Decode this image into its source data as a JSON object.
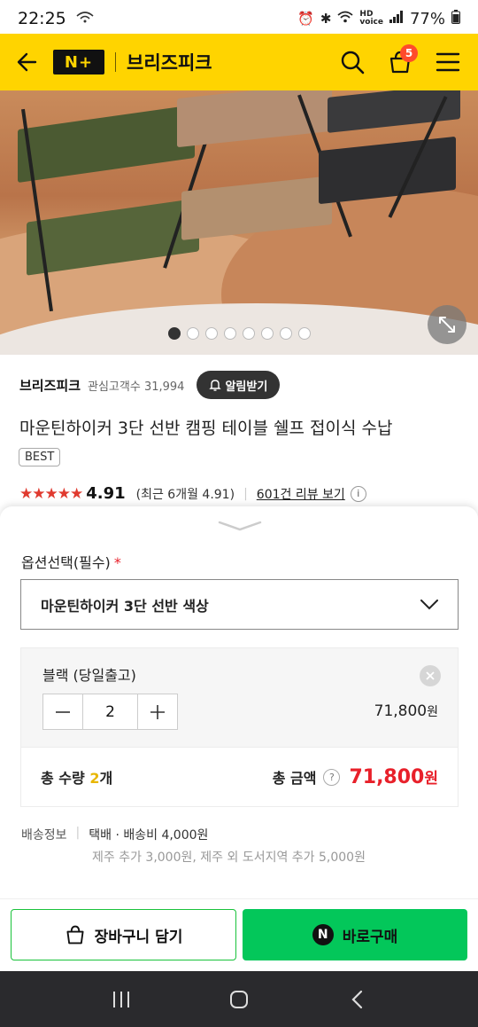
{
  "status_bar": {
    "time": "22:25",
    "left_icons": "wifi",
    "battery": "77%",
    "right_icons": [
      "alarm-icon",
      "bluetooth-icon",
      "wifi-icon",
      "hd-voice-icon",
      "signal-icon",
      "battery-icon"
    ]
  },
  "header": {
    "logo": "N+",
    "title": "브리즈피크",
    "cart_count": "5",
    "bg_color": "#ffd400"
  },
  "hero": {
    "slide_count": 8,
    "active_slide": 1
  },
  "product": {
    "store_name": "브리즈피크",
    "followers": "관심고객수 31,994",
    "alert_button": "알림받기",
    "title": "마운틴하이커 3단 선반 캠핑 테이블 쉘프 접이식 수납",
    "badge": "BEST",
    "stars": "★★★★★",
    "score": "4.91",
    "recent_score": "(최근 6개월 4.91)",
    "review_link": "601건 리뷰 보기"
  },
  "sheet": {
    "option_label": "옵션선택(필수)",
    "required_mark": "*",
    "select_value": "마운틴하이커 3단 선반 색상",
    "selected_option": {
      "name": "블랙 (당일출고)",
      "quantity": "2",
      "price": "71,800",
      "currency": "원"
    },
    "total_qty_label": "총 수량",
    "total_qty_value": "2",
    "total_qty_unit": "개",
    "total_price_label": "총 금액",
    "total_price": "71,800",
    "currency": "원",
    "shipping_label": "배송정보",
    "shipping_info": "택배 · 배송비 4,000원",
    "shipping_extra": "제주 추가 3,000원, 제주 외 도서지역 추가 5,000원"
  },
  "buttons": {
    "cart": "장바구니 담기",
    "buy": "바로구매",
    "buy_icon": "N",
    "buy_color": "#03c75a",
    "price_color": "#e8202a"
  }
}
